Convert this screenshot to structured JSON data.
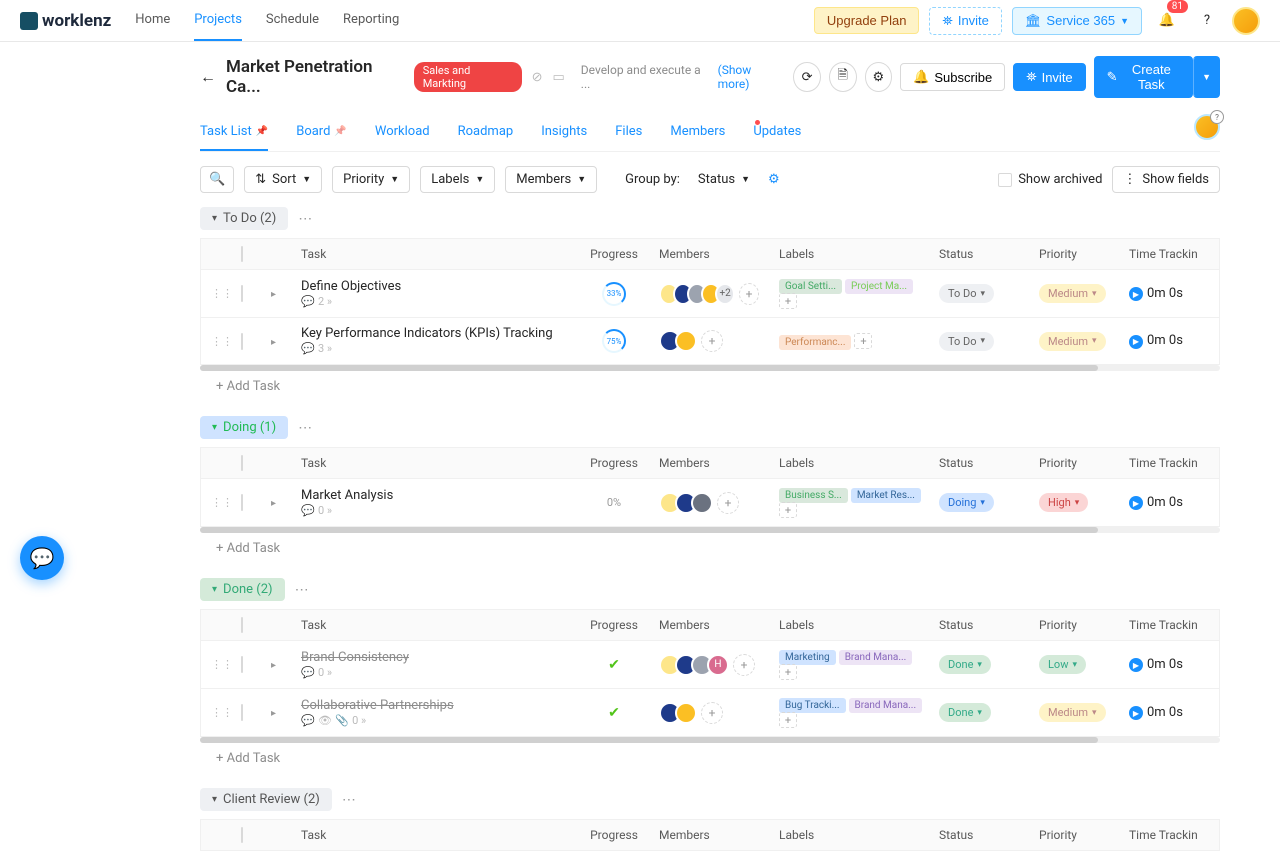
{
  "brand": "worklenz",
  "nav": [
    "Home",
    "Projects",
    "Schedule",
    "Reporting"
  ],
  "nav_active": 1,
  "top_actions": {
    "upgrade": "Upgrade Plan",
    "invite": "Invite",
    "service": "Service 365",
    "notif_count": "81"
  },
  "project": {
    "title": "Market Penetration Ca...",
    "label": {
      "text": "Sales and Markting",
      "bg": "#ef4444"
    },
    "desc": "Develop and execute a ...",
    "show_more": "(Show more)",
    "subscribe": "Subscribe",
    "invite": "Invite",
    "create_task": "Create Task"
  },
  "tabs": [
    "Task List",
    "Board",
    "Workload",
    "Roadmap",
    "Insights",
    "Files",
    "Members",
    "Updates"
  ],
  "tabs_active": 0,
  "toolbar": {
    "sort": "Sort",
    "priority": "Priority",
    "labels": "Labels",
    "members": "Members",
    "group_by_label": "Group by:",
    "group_by_value": "Status",
    "show_archived": "Show archived",
    "show_fields": "Show fields"
  },
  "columns": [
    "Task",
    "Progress",
    "Members",
    "Labels",
    "Status",
    "Priority",
    "Time Trackin"
  ],
  "add_task": "+ Add Task",
  "sections": [
    {
      "title": "To Do (2)",
      "pill_bg": "#eef0f3",
      "pill_color": "#555",
      "rows": [
        {
          "name": "Define Objectives",
          "done": false,
          "sub": "2",
          "progress": "33%",
          "progress_type": "ring",
          "members": [
            {
              "bg": "#fde68a"
            },
            {
              "bg": "#1e3a8a"
            },
            {
              "bg": "#9ca3af"
            },
            {
              "bg": "#fbbf24"
            },
            {
              "bg": "#e5e7eb",
              "text": "+2",
              "color": "#666"
            }
          ],
          "labels": [
            {
              "text": "Goal Setti...",
              "bg": "#d9e8dc",
              "color": "#4a6"
            },
            {
              "text": "Project Ma...",
              "bg": "#ede4f5",
              "color": "#7c5"
            }
          ],
          "status": {
            "text": "To Do",
            "bg": "#eef0f3",
            "color": "#666"
          },
          "priority": {
            "text": "Medium",
            "bg": "#fef3c7",
            "color": "#b88"
          },
          "time": "0m 0s"
        },
        {
          "name": "Key Performance Indicators (KPIs) Tracking",
          "done": false,
          "sub": "3",
          "progress": "75%",
          "progress_type": "ring",
          "members": [
            {
              "bg": "#1e3a8a"
            },
            {
              "bg": "#fbbf24"
            }
          ],
          "labels": [
            {
              "text": "Performanc...",
              "bg": "#fde4d4",
              "color": "#c85"
            }
          ],
          "status": {
            "text": "To Do",
            "bg": "#eef0f3",
            "color": "#666"
          },
          "priority": {
            "text": "Medium",
            "bg": "#fef3c7",
            "color": "#b88"
          },
          "time": "0m 0s"
        }
      ]
    },
    {
      "title": "Doing (1)",
      "pill_bg": "#cfe3ff",
      "pill_color": "#2b5",
      "rows": [
        {
          "name": "Market Analysis",
          "done": false,
          "sub": "0",
          "progress": "0%",
          "progress_type": "text",
          "members": [
            {
              "bg": "#fde68a"
            },
            {
              "bg": "#1e3a8a"
            },
            {
              "bg": "#6b7280"
            }
          ],
          "labels": [
            {
              "text": "Business S...",
              "bg": "#d9e8dc",
              "color": "#4a6"
            },
            {
              "text": "Market Res...",
              "bg": "#cfe3ff",
              "color": "#369"
            }
          ],
          "status": {
            "text": "Doing",
            "bg": "#cfe3ff",
            "color": "#2470d8"
          },
          "priority": {
            "text": "High",
            "bg": "#fbd5d5",
            "color": "#c44"
          },
          "time": "0m 0s"
        }
      ]
    },
    {
      "title": "Done (2)",
      "pill_bg": "#d4ead9",
      "pill_color": "#3a7",
      "rows": [
        {
          "name": "Brand Consistency",
          "done": true,
          "sub": "0",
          "progress": "✓",
          "progress_type": "done",
          "members": [
            {
              "bg": "#fde68a"
            },
            {
              "bg": "#1e3a8a"
            },
            {
              "bg": "#9ca3af"
            },
            {
              "bg": "#d96b8f",
              "text": "H"
            }
          ],
          "labels": [
            {
              "text": "Marketing",
              "bg": "#cfe3ff",
              "color": "#369"
            },
            {
              "text": "Brand Mana...",
              "bg": "#ede4f5",
              "color": "#86b"
            }
          ],
          "status": {
            "text": "Done",
            "bg": "#d4ead9",
            "color": "#3a8"
          },
          "priority": {
            "text": "Low",
            "bg": "#d4ead9",
            "color": "#3a8"
          },
          "time": "0m 0s"
        },
        {
          "name": "Collaborative Partnerships",
          "done": true,
          "sub": "0",
          "attach": true,
          "progress": "✓",
          "progress_type": "done",
          "members": [
            {
              "bg": "#1e3a8a"
            },
            {
              "bg": "#fbbf24"
            }
          ],
          "labels": [
            {
              "text": "Bug Tracki...",
              "bg": "#cfe3ff",
              "color": "#369"
            },
            {
              "text": "Brand Mana...",
              "bg": "#ede4f5",
              "color": "#86b"
            }
          ],
          "status": {
            "text": "Done",
            "bg": "#d4ead9",
            "color": "#3a8"
          },
          "priority": {
            "text": "Medium",
            "bg": "#fef3c7",
            "color": "#b88"
          },
          "time": "0m 0s"
        }
      ]
    },
    {
      "title": "Client Review (2)",
      "pill_bg": "#eef0f3",
      "pill_color": "#555",
      "rows": []
    }
  ]
}
